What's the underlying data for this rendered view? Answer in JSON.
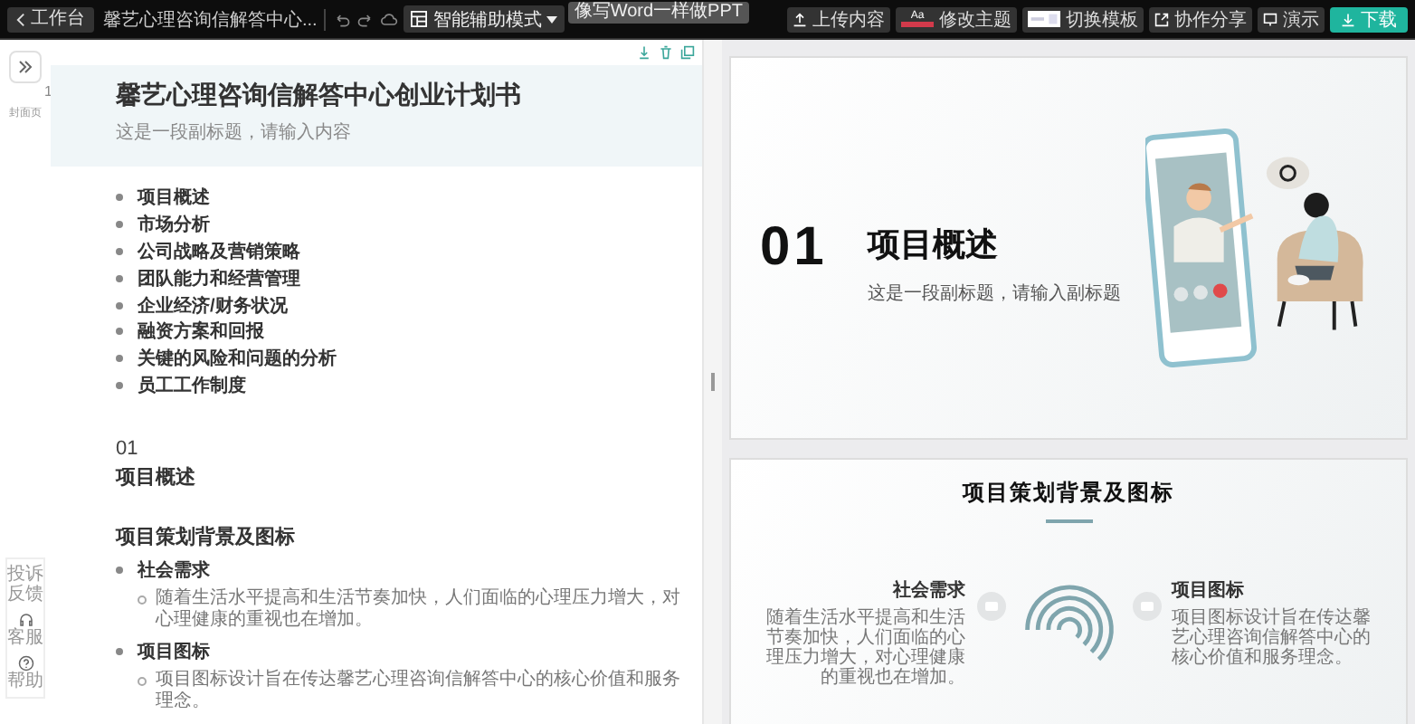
{
  "topbar": {
    "back": "工作台",
    "doc_title": "馨艺心理咨询信解答中心...",
    "mode": "智能辅助模式",
    "tooltip": "像写Word一样做PPT",
    "actions": [
      {
        "label": "上传内容",
        "kind": "upload"
      },
      {
        "label": "修改主题",
        "kind": "theme",
        "swatch": "Aa"
      },
      {
        "label": "切换模板",
        "kind": "template"
      },
      {
        "label": "协作分享",
        "kind": "share"
      },
      {
        "label": "演示",
        "kind": "present"
      },
      {
        "label": "下载",
        "kind": "download"
      }
    ]
  },
  "side_rail": {
    "page_number": "1",
    "page_label": "封面页",
    "tools": [
      {
        "label": "投诉反馈",
        "kind": "feedback"
      },
      {
        "label": "客服",
        "kind": "service"
      },
      {
        "label": "帮助",
        "kind": "help"
      }
    ]
  },
  "outline": {
    "title": "馨艺心理咨询信解答中心创业计划书",
    "subtitle": "这是一段副标题，请输入内容",
    "toc": [
      "项目概述",
      "市场分析",
      "公司战略及营销策略",
      "团队能力和经营管理",
      "企业经济/财务状况",
      "融资方案和回报",
      "关键的风险和问题的分析",
      "员工工作制度"
    ],
    "chapter": {
      "number": "01",
      "title": "项目概述"
    },
    "section": {
      "heading": "项目策划背景及图标",
      "items": [
        {
          "text": "社会需求",
          "children": [
            {
              "text": "随着生活水平提高和生活节奏加快，人们面临的心理压力增大，对心理健康的重视也在增加。"
            }
          ]
        },
        {
          "text": "项目图标",
          "children": [
            {
              "text": "项目图标设计旨在传达馨艺心理咨询信解答中心的核心价值和服务理念。"
            }
          ]
        }
      ]
    }
  },
  "slides": [
    {
      "kind": "cover",
      "number": "01",
      "title": "项目概述",
      "subtitle": "这是一段副标题，请输入副标题"
    },
    {
      "kind": "points",
      "title": "项目策划背景及图标",
      "points": [
        {
          "title": "社会需求",
          "text": "随着生活水平提高和生活节奏加快，人们面临的心理压力增大，对心理健康的重视也在增加。"
        },
        {
          "title": "项目图标",
          "text": "项目图标设计旨在传达馨艺心理咨询信解答中心的核心价值和服务理念。"
        }
      ]
    }
  ]
}
